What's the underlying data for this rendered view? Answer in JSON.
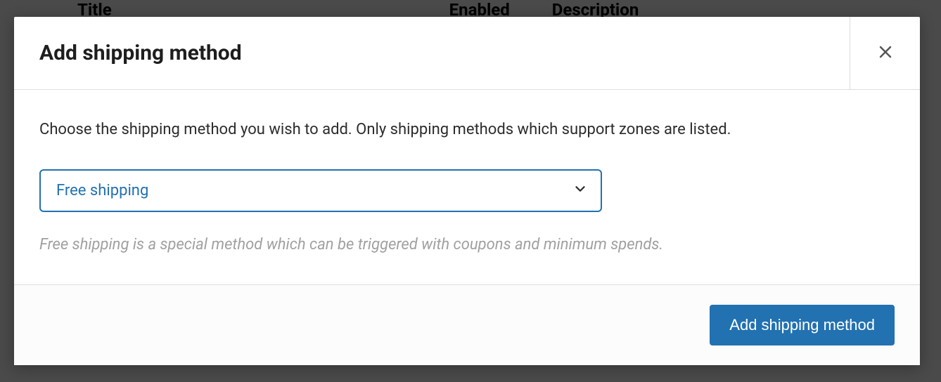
{
  "background": {
    "titleHeader": "Title",
    "enabledHeader": "Enabled",
    "descriptionHeader": "Description"
  },
  "modal": {
    "title": "Add shipping method",
    "instruction": "Choose the shipping method you wish to add. Only shipping methods which support zones are listed.",
    "select": {
      "selected": "Free shipping"
    },
    "helperText": "Free shipping is a special method which can be triggered with coupons and minimum spends.",
    "footer": {
      "submitLabel": "Add shipping method"
    }
  }
}
